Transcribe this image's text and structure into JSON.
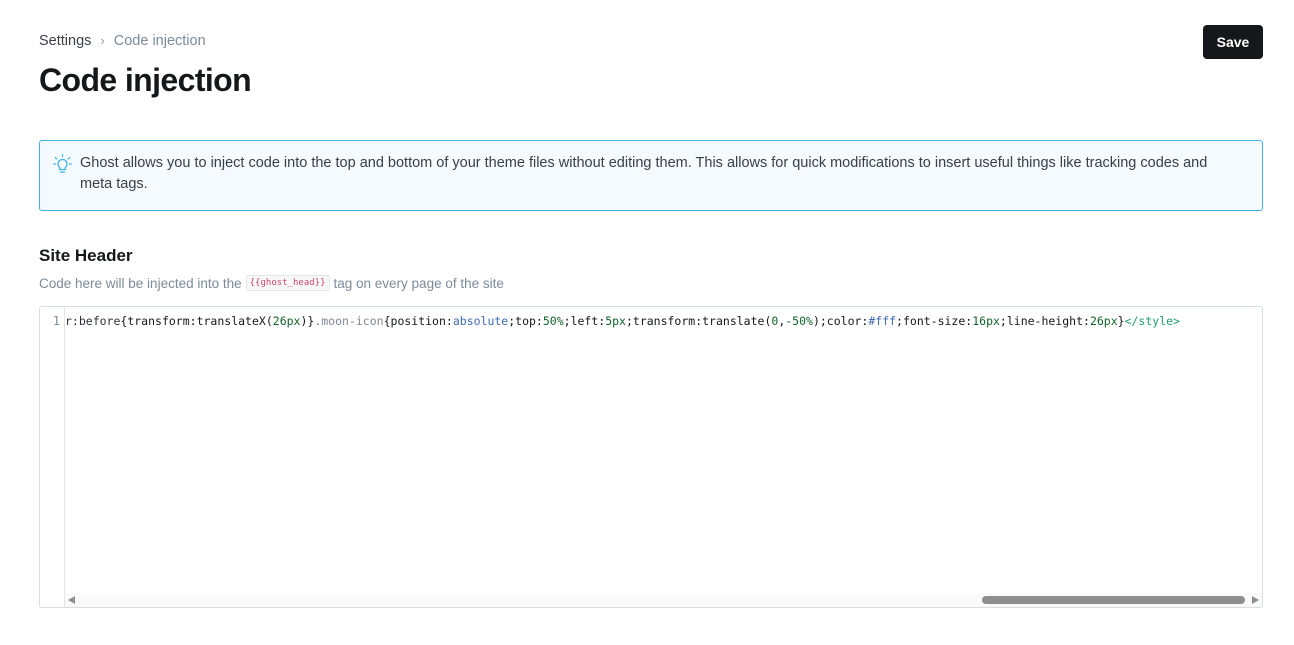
{
  "breadcrumb": {
    "root": "Settings",
    "separator": "›",
    "current": "Code injection"
  },
  "page": {
    "title": "Code injection"
  },
  "toolbar": {
    "save_label": "Save"
  },
  "info": {
    "icon": "lightbulb-icon",
    "text": "Ghost allows you to inject code into the top and bottom of your theme files without editing them. This allows for quick modifications to insert useful things like tracking codes and meta tags."
  },
  "site_header": {
    "title": "Site Header",
    "desc_before": "Code here will be injected into the",
    "tag": "{{ghost_head}}",
    "desc_after": "tag on every page of the site"
  },
  "editor": {
    "line_number": "1",
    "tokens": [
      {
        "t": "r:before",
        "c": "c-sel"
      },
      {
        "t": "{",
        "c": "c-prop"
      },
      {
        "t": "transform",
        "c": "c-prop"
      },
      {
        "t": ":",
        "c": "c-prop"
      },
      {
        "t": "translateX",
        "c": "c-prop"
      },
      {
        "t": "(",
        "c": "c-prop"
      },
      {
        "t": "26px",
        "c": "c-val-num"
      },
      {
        "t": ")}",
        "c": "c-prop"
      },
      {
        "t": ".moon-icon",
        "c": "c-cls"
      },
      {
        "t": "{",
        "c": "c-prop"
      },
      {
        "t": "position",
        "c": "c-prop"
      },
      {
        "t": ":",
        "c": "c-prop"
      },
      {
        "t": "absolute",
        "c": "c-val-kw"
      },
      {
        "t": ";top:",
        "c": "c-prop"
      },
      {
        "t": "50%",
        "c": "c-val-num"
      },
      {
        "t": ";left:",
        "c": "c-prop"
      },
      {
        "t": "5px",
        "c": "c-val-num"
      },
      {
        "t": ";transform:translate(",
        "c": "c-prop"
      },
      {
        "t": "0",
        "c": "c-val-num"
      },
      {
        "t": ",",
        "c": "c-prop"
      },
      {
        "t": "-50%",
        "c": "c-val-num"
      },
      {
        "t": ");color:",
        "c": "c-prop"
      },
      {
        "t": "#fff",
        "c": "c-hex"
      },
      {
        "t": ";font-size:",
        "c": "c-prop"
      },
      {
        "t": "16px",
        "c": "c-val-num"
      },
      {
        "t": ";line-height:",
        "c": "c-prop"
      },
      {
        "t": "26px",
        "c": "c-val-num"
      },
      {
        "t": "}",
        "c": "c-prop"
      },
      {
        "t": "</style>",
        "c": "c-tag"
      }
    ]
  },
  "colors": {
    "accent": "#42b2e8",
    "info_bg": "#f4fafd",
    "button_bg": "#15171a"
  }
}
